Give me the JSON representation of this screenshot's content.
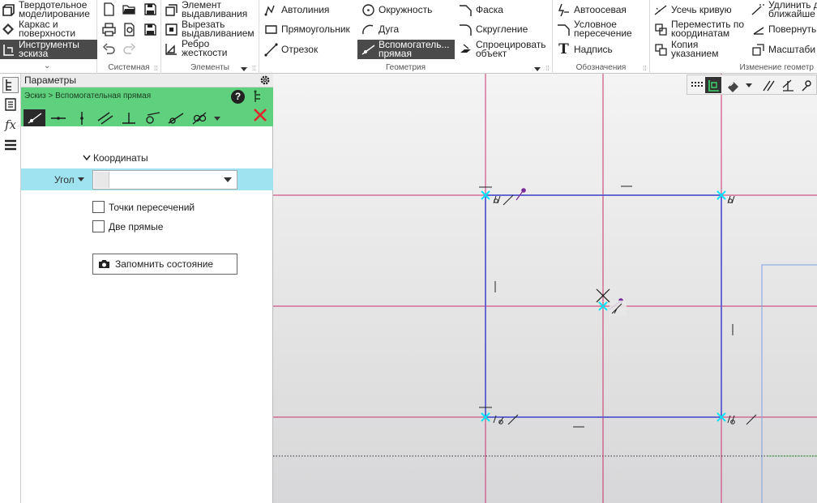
{
  "ribbon": {
    "modes": [
      {
        "label": "Твердотельное моделирование",
        "line1": "Твердотельное",
        "line2": "моделирование",
        "icon": "solid-modeling-icon"
      },
      {
        "label": "Каркас и поверхности",
        "line1": "Каркас и",
        "line2": "поверхности",
        "icon": "wireframe-surface-icon"
      },
      {
        "label": "Инструменты эскиза",
        "line1": "Инструменты",
        "line2": "эскиза",
        "icon": "sketch-tools-icon",
        "selected": true
      }
    ],
    "groups": {
      "system": "Системная",
      "elements": "Элементы",
      "geometry": "Геометрия",
      "annotations": "Обозначения",
      "modify": "Изменение геометр"
    },
    "system_icons": [
      "new-file-icon",
      "open-folder-icon",
      "save-icon",
      "print-icon",
      "preview-icon",
      "save-as-icon",
      "undo-icon",
      "redo-icon"
    ],
    "elements": [
      {
        "line1": "Элемент",
        "line2": "выдавливания",
        "icon": "extrude-icon"
      },
      {
        "line1": "Вырезать",
        "line2": "выдавливанием",
        "icon": "cut-extrude-icon"
      },
      {
        "line1": "Ребро",
        "line2": "жесткости",
        "icon": "rib-icon"
      }
    ],
    "geometry": [
      {
        "label": "Автолиния",
        "icon": "autoline-icon"
      },
      {
        "label": "Прямоугольник",
        "icon": "rectangle-icon"
      },
      {
        "label": "Отрезок",
        "icon": "segment-icon"
      },
      {
        "label": "Окружность",
        "icon": "circle-icon"
      },
      {
        "label": "Дуга",
        "icon": "arc-icon"
      },
      {
        "line1": "Вспомогатель...",
        "line2": "прямая",
        "icon": "construction-line-icon",
        "selected": true
      },
      {
        "label": "Фаска",
        "icon": "chamfer-icon"
      },
      {
        "label": "Скругление",
        "icon": "fillet-icon"
      },
      {
        "line1": "Спроецировать",
        "line2": "объект",
        "icon": "project-object-icon"
      }
    ],
    "annotations": [
      {
        "label": "Автоосевая",
        "icon": "auto-axis-icon"
      },
      {
        "line1": "Условное",
        "line2": "пересечение",
        "icon": "conditional-intersection-icon"
      },
      {
        "label": "Надпись",
        "icon": "text-label-icon"
      }
    ],
    "modify": [
      {
        "label": "Усечь кривую",
        "icon": "trim-curve-icon"
      },
      {
        "line1": "Переместить по",
        "line2": "координатам",
        "icon": "move-coords-icon"
      },
      {
        "line1": "Копия",
        "line2": "указанием",
        "icon": "copy-icon"
      },
      {
        "line1": "Удлинить д",
        "line2": "ближайше",
        "icon": "extend-icon"
      },
      {
        "label": "Повернуть",
        "icon": "rotate-icon"
      },
      {
        "label": "Масштаби",
        "icon": "scale-icon"
      }
    ]
  },
  "left_strip": [
    {
      "icon": "tree-icon",
      "selected": true
    },
    {
      "icon": "properties-icon"
    },
    {
      "icon": "function-icon",
      "text": "fx"
    },
    {
      "icon": "layers-icon"
    }
  ],
  "panel": {
    "title": "Параметры",
    "breadcrumb": "Эскиз > Вспомогательная прямая",
    "help_label": "?",
    "modes": [
      "any-line-icon",
      "horizontal-line-icon",
      "vertical-line-icon",
      "parallel-line-icon",
      "perpendicular-line-icon",
      "tangent-line-icon",
      "tangent-2-line-icon",
      "bisector-line-icon"
    ],
    "section_title": "Координаты",
    "angle_label": "Угол",
    "angle_value": "",
    "checkboxes": [
      {
        "label": "Точки пересечений",
        "checked": false
      },
      {
        "label": "Две прямые",
        "checked": false
      }
    ],
    "save_button": "Запомнить состояние"
  },
  "colors": {
    "accent_green": "#5fd07d",
    "highlight_row": "#9ee3ef",
    "construction_line": "#c8326e",
    "sketch_line": "#5a5ad0",
    "snap_point": "#00e5ff"
  }
}
